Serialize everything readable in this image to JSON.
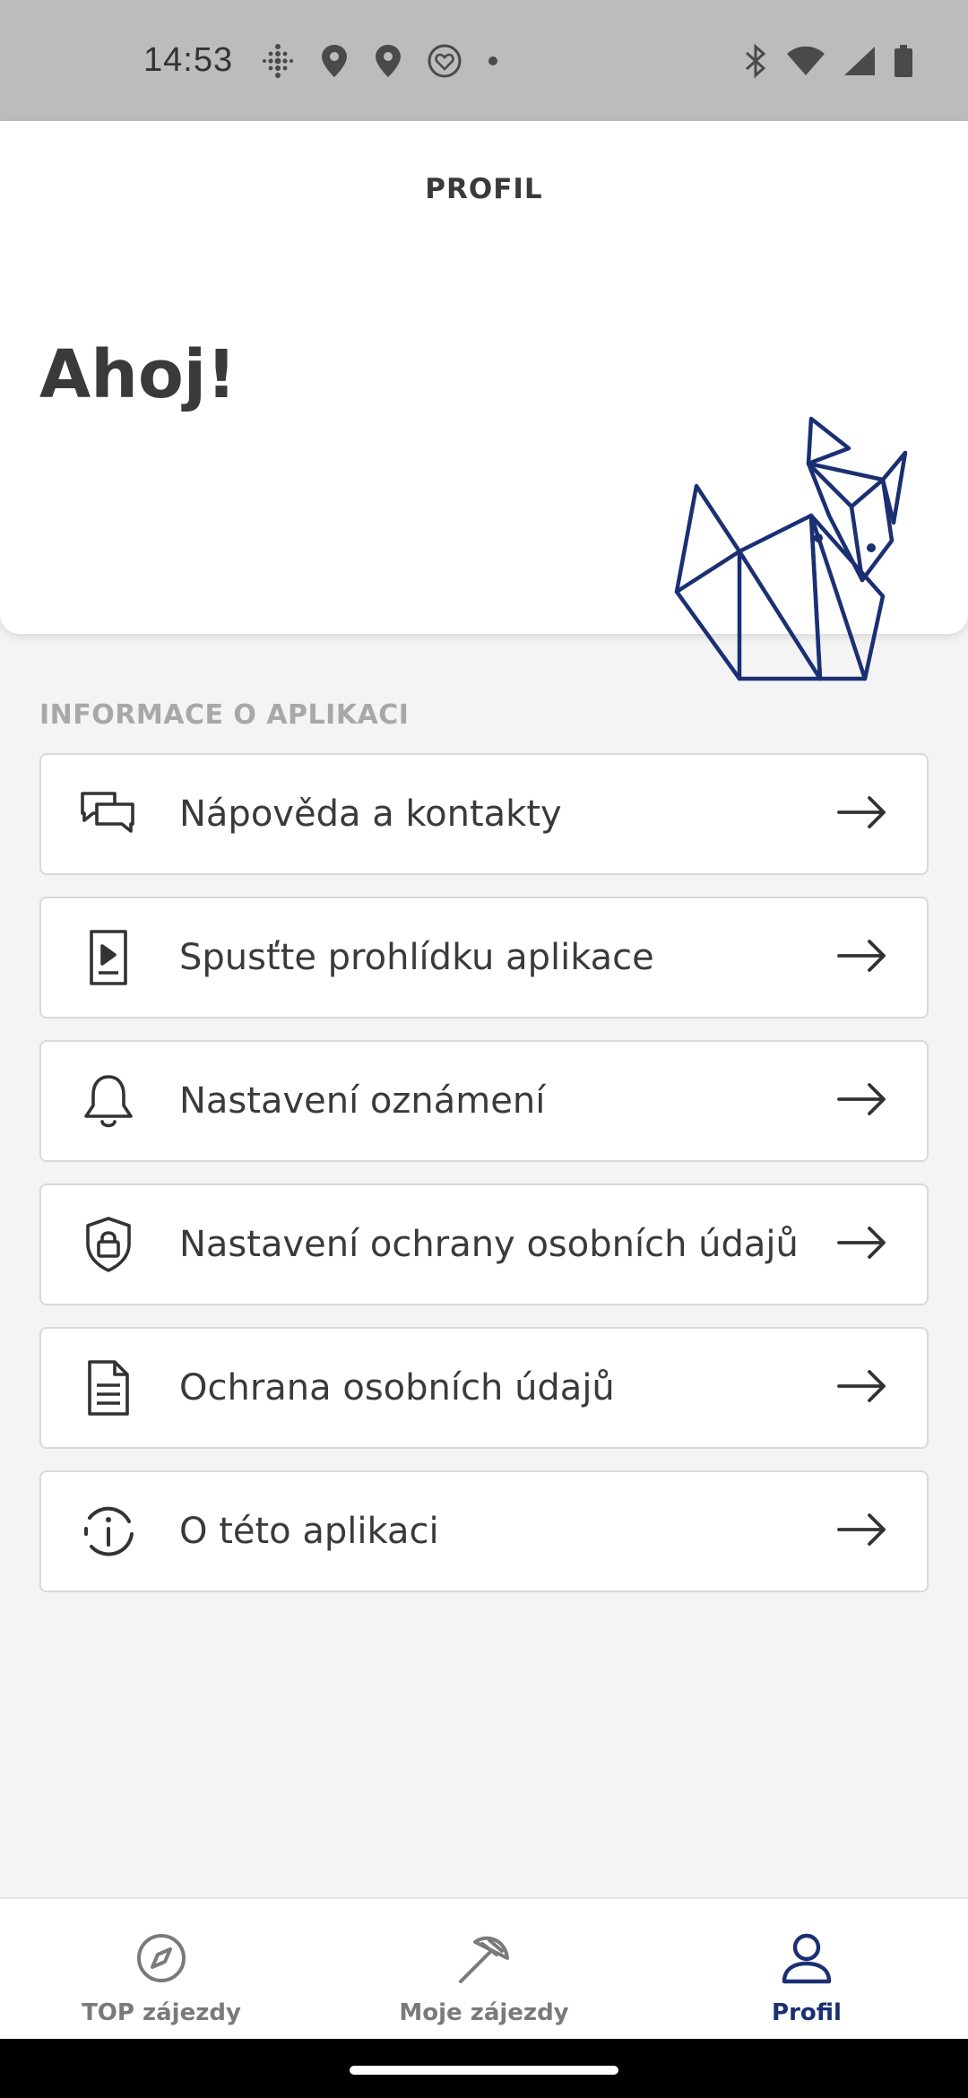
{
  "status_bar": {
    "time": "14:53",
    "left_icons": [
      "fitbit-icon",
      "location-pin-icon",
      "location-pin-icon",
      "heart-badge-icon",
      "notification-dot-icon"
    ],
    "right_icons": [
      "bluetooth-icon",
      "wifi-icon",
      "signal-icon",
      "battery-icon"
    ]
  },
  "header": {
    "title": "PROFIL"
  },
  "profile": {
    "greeting": "Ahoj!",
    "illustration": "origami-fox",
    "brand_color": "#1b2f73"
  },
  "section": {
    "title": "INFORMACE O APLIKACI"
  },
  "menu": {
    "items": [
      {
        "label": "Nápověda a kontakty",
        "icon": "chat-bubbles-icon"
      },
      {
        "label": "Spusťte prohlídku aplikace",
        "icon": "tour-device-icon"
      },
      {
        "label": "Nastavení oznámení",
        "icon": "bell-icon"
      },
      {
        "label": "Nastavení ochrany osobních údajů",
        "icon": "shield-lock-icon"
      },
      {
        "label": "Ochrana osobních údajů",
        "icon": "document-icon"
      },
      {
        "label": "O této aplikaci",
        "icon": "info-icon"
      }
    ],
    "arrow_icon": "arrow-right-icon"
  },
  "bottom_nav": {
    "items": [
      {
        "label": "TOP zájezdy",
        "icon": "compass-icon",
        "active": false
      },
      {
        "label": "Moje zájezdy",
        "icon": "beach-umbrella-icon",
        "active": false
      },
      {
        "label": "Profil",
        "icon": "person-icon",
        "active": true
      }
    ],
    "active_color": "#1b2f73",
    "inactive_color": "#7a7a7a"
  }
}
